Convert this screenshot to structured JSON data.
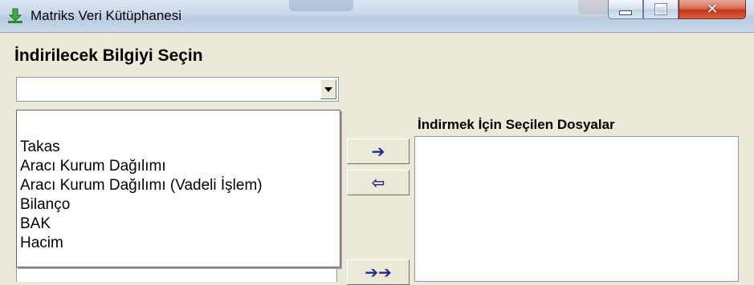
{
  "window": {
    "title": "Matriks Veri Kütüphanesi",
    "icon": "download-arrow-icon",
    "buttons": {
      "minimize": "minimize-icon",
      "maximize": "maximize-icon",
      "close": "✕"
    }
  },
  "main": {
    "heading": "İndirilecek Bilgiyi Seçin",
    "combo": {
      "value": "",
      "icon": "chevron-down-icon"
    },
    "dropdown_items": [
      "",
      "Takas",
      "Aracı Kurum Dağılımı",
      "Aracı Kurum Dağılımı (Vadeli İşlem)",
      "Bilanço",
      "BAK",
      "Hacim"
    ],
    "selected_files_label": "İndirmek İçin Seçilen Dosyalar",
    "transfer_buttons": {
      "add": "➔",
      "remove": "⇦",
      "add_all": "➔➔"
    }
  },
  "colors": {
    "window_bg": "#ece9d8",
    "arrow_blue": "#1b2c8c",
    "close_red": "#c1391c"
  }
}
